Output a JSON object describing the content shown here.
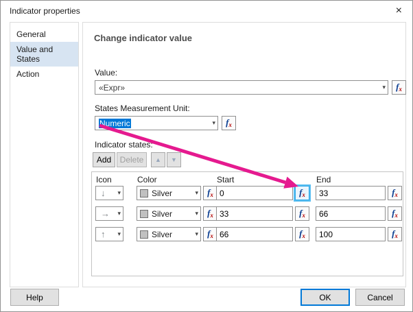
{
  "dialog": {
    "title": "Indicator properties"
  },
  "icons": {
    "close": "×",
    "chevron_down": "▾",
    "move_up": "▲",
    "move_down": "▼"
  },
  "sidebar": {
    "items": [
      {
        "label": "General"
      },
      {
        "label": "Value and States"
      },
      {
        "label": "Action"
      }
    ],
    "selected": "Value and States"
  },
  "main": {
    "heading": "Change indicator value",
    "value": {
      "label": "Value:",
      "selected": "«Expr»"
    },
    "unit": {
      "label": "States Measurement Unit:",
      "selected": "Numeric",
      "selection_highlight": "#0078d7"
    },
    "states": {
      "label": "Indicator states:",
      "add_label": "Add",
      "delete_label": "Delete",
      "headers": {
        "icon": "Icon",
        "color": "Color",
        "start": "Start",
        "end": "End"
      },
      "rows": [
        {
          "icon_glyph": "↓",
          "icon_name": "down-arrow",
          "color": "Silver",
          "start": "0",
          "end": "33"
        },
        {
          "icon_glyph": "→",
          "icon_name": "right-arrow",
          "color": "Silver",
          "start": "33",
          "end": "66"
        },
        {
          "icon_glyph": "↑",
          "icon_name": "up-arrow",
          "color": "Silver",
          "start": "66",
          "end": "100"
        }
      ],
      "swatch_color": "#c0c0c0"
    }
  },
  "fx": {
    "f": "f",
    "x": "x"
  },
  "footer": {
    "help": "Help",
    "ok": "OK",
    "cancel": "Cancel"
  },
  "annotation": {
    "color": "#e51a8f"
  }
}
